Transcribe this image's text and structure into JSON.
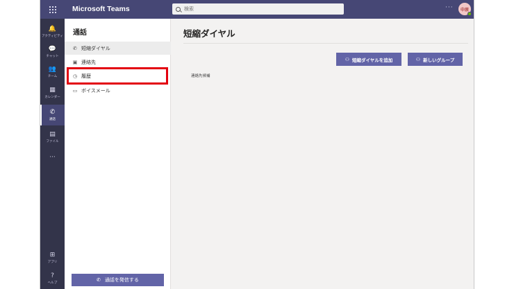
{
  "app": {
    "title": "Microsoft Teams"
  },
  "search": {
    "placeholder": "検索"
  },
  "header": {
    "more": "···",
    "avatar_initials": "中原"
  },
  "rail": {
    "items": [
      {
        "icon": "bell-icon",
        "glyph": "🔔",
        "label": "アクティビティ"
      },
      {
        "icon": "chat-icon",
        "glyph": "💬",
        "label": "チャット"
      },
      {
        "icon": "teams-icon",
        "glyph": "👥",
        "label": "チーム"
      },
      {
        "icon": "calendar-icon",
        "glyph": "▦",
        "label": "カレンダー"
      },
      {
        "icon": "phone-icon",
        "glyph": "✆",
        "label": "通話"
      },
      {
        "icon": "file-icon",
        "glyph": "▤",
        "label": "ファイル"
      },
      {
        "icon": "more-icon",
        "glyph": "···",
        "label": ""
      }
    ],
    "bottom": [
      {
        "icon": "apps-icon",
        "glyph": "⊞",
        "label": "アプリ"
      },
      {
        "icon": "help-icon",
        "glyph": "?",
        "label": "ヘルプ"
      }
    ]
  },
  "pane": {
    "title": "通話",
    "items": [
      {
        "icon": "phone-icon",
        "glyph": "✆",
        "label": "短縮ダイヤル"
      },
      {
        "icon": "contacts-icon",
        "glyph": "▣",
        "label": "連絡先"
      },
      {
        "icon": "history-icon",
        "glyph": "◷",
        "label": "履歴"
      },
      {
        "icon": "voicemail-icon",
        "glyph": "▭",
        "label": "ボイスメール"
      }
    ],
    "call_button": "通話を発信する"
  },
  "main": {
    "title": "短縮ダイヤル",
    "add_speed_dial": "短縮ダイヤルを追加",
    "new_group": "新しいグループ",
    "empty_text": "連絡先候補"
  },
  "colors": {
    "titlebar": "#464775",
    "rail": "#33344a",
    "accent": "#6264a7",
    "highlight": "#e3000f"
  }
}
